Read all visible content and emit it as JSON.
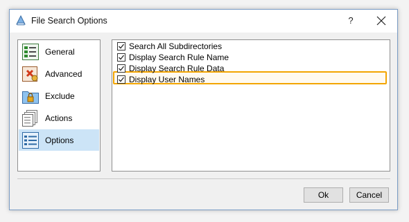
{
  "window": {
    "title": "File Search Options",
    "help_label": "?",
    "close_icon": "close-icon"
  },
  "sidebar": {
    "selected": "Options",
    "items": [
      {
        "label": "General",
        "icon": "general-list-icon"
      },
      {
        "label": "Advanced",
        "icon": "advanced-icon"
      },
      {
        "label": "Exclude",
        "icon": "exclude-folder-lock-icon"
      },
      {
        "label": "Actions",
        "icon": "actions-pages-icon"
      },
      {
        "label": "Options",
        "icon": "options-list-icon"
      }
    ]
  },
  "options": [
    {
      "label": "Search All Subdirectories",
      "checked": true
    },
    {
      "label": "Display Search Rule Name",
      "checked": true
    },
    {
      "label": "Display Search Rule Data",
      "checked": true
    },
    {
      "label": "Display User Names",
      "checked": true,
      "highlighted": true
    }
  ],
  "buttons": {
    "ok_label": "Ok",
    "cancel_label": "Cancel"
  },
  "colors": {
    "highlight_border": "#f3a500",
    "selection_bg": "#cce4f7"
  }
}
